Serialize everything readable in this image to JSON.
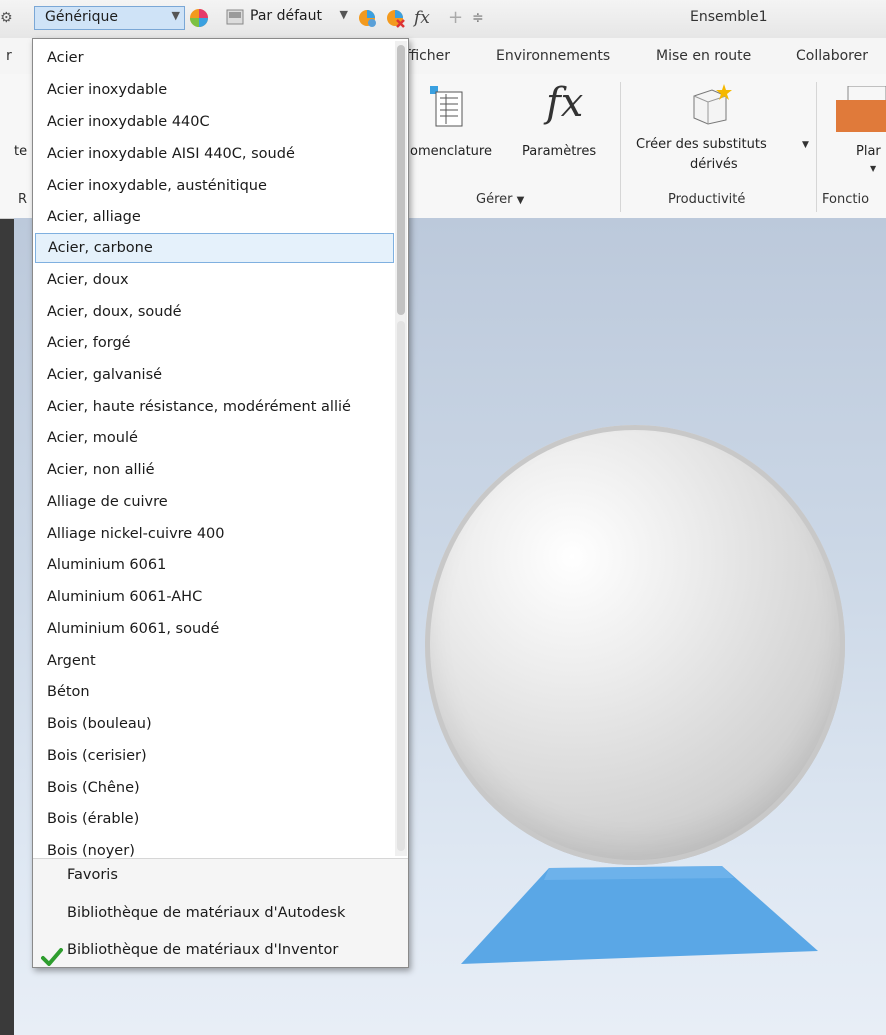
{
  "quick_access": {
    "material_value": "Générique",
    "appearance_value": "Par défaut",
    "document_title": "Ensemble1"
  },
  "ribbon": {
    "tabs": [
      "r",
      "Afficher",
      "Environnements",
      "Mise en route",
      "Collaborer"
    ],
    "buttons": {
      "nomenclature": "omenclature",
      "parameters": "Paramètres",
      "derived_line1": "Créer des substituts",
      "derived_line2": "dérivés",
      "plan": "Plar",
      "left_cut": "te"
    },
    "panels": {
      "left_cut": "R",
      "manage": "Gérer",
      "productivity": "Productivité",
      "features": "Fonctio"
    }
  },
  "material_dropdown": {
    "items": [
      "Acier",
      "Acier inoxydable",
      "Acier inoxydable 440C",
      "Acier inoxydable AISI 440C, soudé",
      "Acier inoxydable, austénitique",
      "Acier, alliage",
      "Acier, carbone",
      "Acier, doux",
      "Acier, doux, soudé",
      "Acier, forgé",
      "Acier, galvanisé",
      "Acier, haute résistance, modérément allié",
      "Acier, moulé",
      "Acier, non allié",
      "Alliage de cuivre",
      "Alliage nickel-cuivre 400",
      "Aluminium 6061",
      "Aluminium 6061-AHC",
      "Aluminium 6061, soudé",
      "Argent",
      "Béton",
      "Bois (bouleau)",
      "Bois (cerisier)",
      "Bois (Chêne)",
      "Bois (érable)",
      "Bois (noyer)"
    ],
    "selected": "Acier, carbone",
    "libraries": {
      "favorites": "Favoris",
      "autodesk": "Bibliothèque de matériaux d'Autodesk",
      "inventor": "Bibliothèque de matériaux d'Inventor"
    },
    "active_library": "inventor"
  },
  "colors": {
    "accent": "#7fb0e0",
    "selected_bg": "#e5f1fb",
    "base_plate": "#5aa7e6",
    "check": "#2e9d2e"
  }
}
